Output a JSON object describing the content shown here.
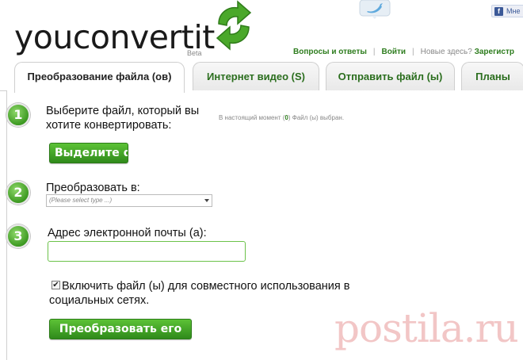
{
  "brand": {
    "logo_you": "you",
    "logo_convert": "convert",
    "logo_it": "it",
    "beta": "Beta",
    "accent": "#3d9a22"
  },
  "social": {
    "twitter_icon": "twitter-bird-icon",
    "facebook_like": "Мне"
  },
  "toplinks": {
    "faq": "Вопросы и ответы",
    "login": "Войти",
    "new_here": "Новые здесь?",
    "register": "Зарегистр"
  },
  "tabs": [
    {
      "label": "Преобразование файла (ов)",
      "active": true
    },
    {
      "label": "Интернет видео (S)",
      "active": false
    },
    {
      "label": "Отправить файл (ы)",
      "active": false
    },
    {
      "label": "Планы",
      "active": false
    }
  ],
  "steps": {
    "step1": {
      "number": "1",
      "line1": "Выберите файл, который вы",
      "line2": "хотите конвертировать:",
      "status_prefix": "В настоящий момент (",
      "status_count": "0",
      "status_suffix": ") Файл (ы) выбран.",
      "button": "Выделите ф"
    },
    "step2": {
      "number": "2",
      "label": "Преобразовать в:",
      "select_placeholder": "(Please select type ...)"
    },
    "step3": {
      "number": "3",
      "label": "Адрес электронной почты (а):",
      "email_value": ""
    }
  },
  "share": {
    "checked": true,
    "line1": "Включить файл (ы) для совместного использования в",
    "line2": "социальных сетях."
  },
  "submit": {
    "label": "Преобразовать его"
  },
  "watermark": "postila.ru"
}
